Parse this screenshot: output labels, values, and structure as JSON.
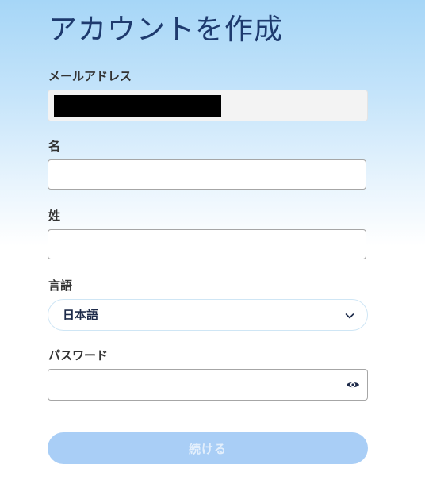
{
  "page": {
    "title": "アカウントを作成"
  },
  "form": {
    "email": {
      "label": "メールアドレス",
      "value": ""
    },
    "first_name": {
      "label": "名",
      "value": ""
    },
    "last_name": {
      "label": "姓",
      "value": ""
    },
    "language": {
      "label": "言語",
      "selected": "日本語"
    },
    "password": {
      "label": "パスワード",
      "value": ""
    },
    "continue_label": "続ける"
  },
  "icons": {
    "language_dropdown": "chevron-down-icon",
    "password_toggle": "eye-icon"
  },
  "colors": {
    "title": "#1e3a6e",
    "button_disabled": "#a9cef6",
    "icon_dark": "#1e2b4a"
  }
}
